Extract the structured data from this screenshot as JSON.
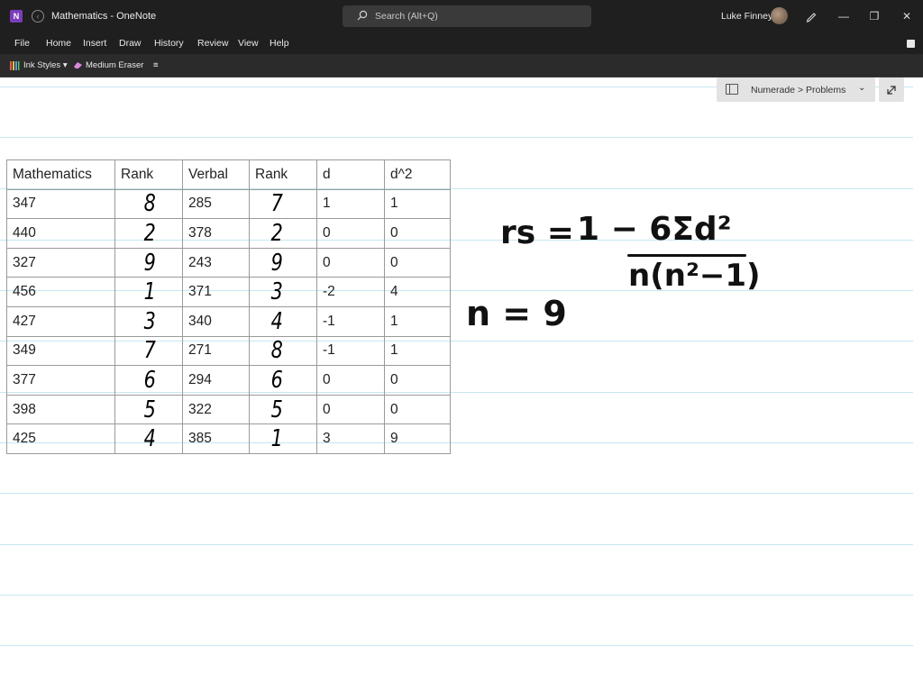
{
  "window": {
    "title": "Mathematics  -  OneNote",
    "app_icon_letter": "N",
    "user_name": "Luke Finney"
  },
  "search": {
    "placeholder": "Search (Alt+Q)"
  },
  "menu": {
    "items": [
      "File",
      "Home",
      "Insert",
      "Draw",
      "History",
      "Review",
      "View",
      "Help"
    ]
  },
  "toolbar": {
    "ink_styles": "Ink Styles",
    "eraser": "Medium Eraser"
  },
  "breadcrumb": {
    "text": "Numerade > Problems"
  },
  "table": {
    "headers": [
      "Mathematics",
      "Rank",
      "Verbal",
      "Rank",
      "d",
      "d^2"
    ],
    "rows": [
      [
        "347",
        "8",
        "285",
        "7",
        "1",
        "1"
      ],
      [
        "440",
        "2",
        "378",
        "2",
        "0",
        "0"
      ],
      [
        "327",
        "9",
        "243",
        "9",
        "0",
        "0"
      ],
      [
        "456",
        "1",
        "371",
        "3",
        "-2",
        "4"
      ],
      [
        "427",
        "3",
        "340",
        "4",
        "-1",
        "1"
      ],
      [
        "349",
        "7",
        "271",
        "8",
        "-1",
        "1"
      ],
      [
        "377",
        "6",
        "294",
        "6",
        "0",
        "0"
      ],
      [
        "398",
        "5",
        "322",
        "5",
        "0",
        "0"
      ],
      [
        "425",
        "4",
        "385",
        "1",
        "3",
        "9"
      ]
    ]
  },
  "ink": {
    "formula_lhs": "rs =",
    "formula_num": "1 − 6Σd²",
    "formula_den": "n(n²−1)",
    "n_value": "n = 9"
  }
}
